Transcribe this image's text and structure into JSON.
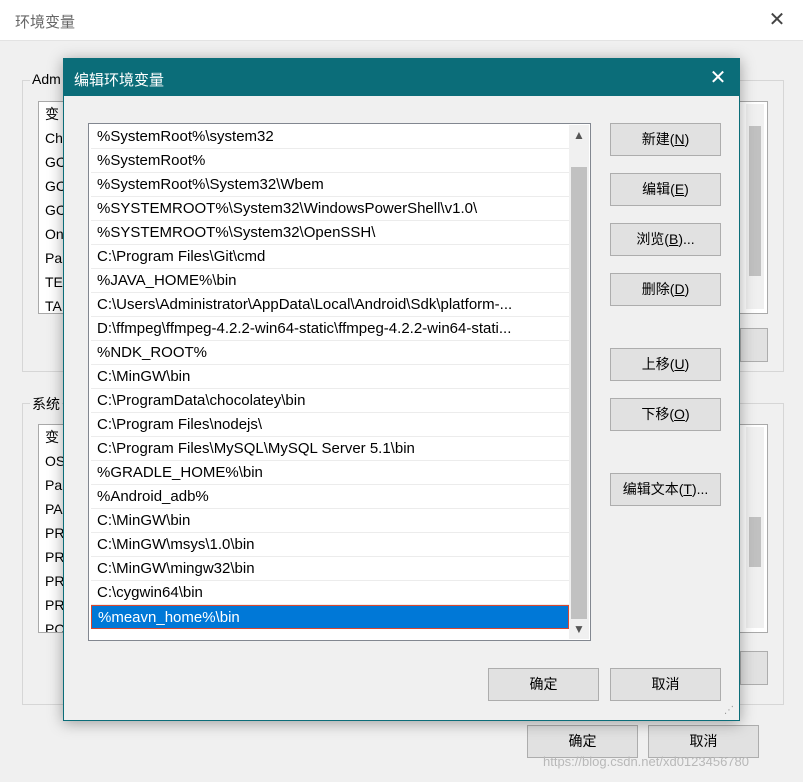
{
  "outer_window": {
    "title": "环境变量",
    "close_glyph": "✕",
    "user_group_label": "Adm",
    "system_group_label": "系统",
    "user_list_rows": [
      "变",
      "Ch",
      "GC",
      "GC",
      "GC",
      "On",
      "Pa",
      "TE",
      "TA"
    ],
    "system_list_rows": [
      "变",
      "OS",
      "Pa",
      "PA",
      "PR",
      "PR",
      "PR",
      "PR",
      "PC"
    ],
    "ok_button": "确定",
    "cancel_button": "取消"
  },
  "dialog": {
    "title": "编辑环境变量",
    "close_glyph": "✕",
    "paths": [
      "%SystemRoot%\\system32",
      "%SystemRoot%",
      "%SystemRoot%\\System32\\Wbem",
      "%SYSTEMROOT%\\System32\\WindowsPowerShell\\v1.0\\",
      "%SYSTEMROOT%\\System32\\OpenSSH\\",
      "C:\\Program Files\\Git\\cmd",
      "%JAVA_HOME%\\bin",
      "C:\\Users\\Administrator\\AppData\\Local\\Android\\Sdk\\platform-...",
      "D:\\ffmpeg\\ffmpeg-4.2.2-win64-static\\ffmpeg-4.2.2-win64-stati...",
      "%NDK_ROOT%",
      "C:\\MinGW\\bin",
      "C:\\ProgramData\\chocolatey\\bin",
      "C:\\Program Files\\nodejs\\",
      "C:\\Program Files\\MySQL\\MySQL Server 5.1\\bin",
      "%GRADLE_HOME%\\bin",
      "%Android_adb%",
      "C:\\MinGW\\bin",
      "C:\\MinGW\\msys\\1.0\\bin",
      "C:\\MinGW\\mingw32\\bin",
      "C:\\cygwin64\\bin",
      "%meavn_home%\\bin"
    ],
    "selected_index": 20,
    "buttons": {
      "new": {
        "text": "新建(",
        "key": "N",
        "end": ")"
      },
      "edit": {
        "text": "编辑(",
        "key": "E",
        "end": ")"
      },
      "browse": {
        "text": "浏览(",
        "key": "B",
        "end": ")..."
      },
      "delete": {
        "text": "删除(",
        "key": "D",
        "end": ")"
      },
      "move_up": {
        "text": "上移(",
        "key": "U",
        "end": ")"
      },
      "move_down": {
        "text": "下移(",
        "key": "O",
        "end": ")"
      },
      "edit_text": {
        "text": "编辑文本(",
        "key": "T",
        "end": ")..."
      },
      "ok": "确定",
      "cancel": "取消"
    },
    "scroll_up_glyph": "▲",
    "scroll_down_glyph": "▼"
  },
  "watermark": "https://blog.csdn.net/xd0123456780",
  "colors": {
    "title_bar": "#0b6d79",
    "selection": "#0078d7",
    "selection_outline": "#d8472f"
  }
}
